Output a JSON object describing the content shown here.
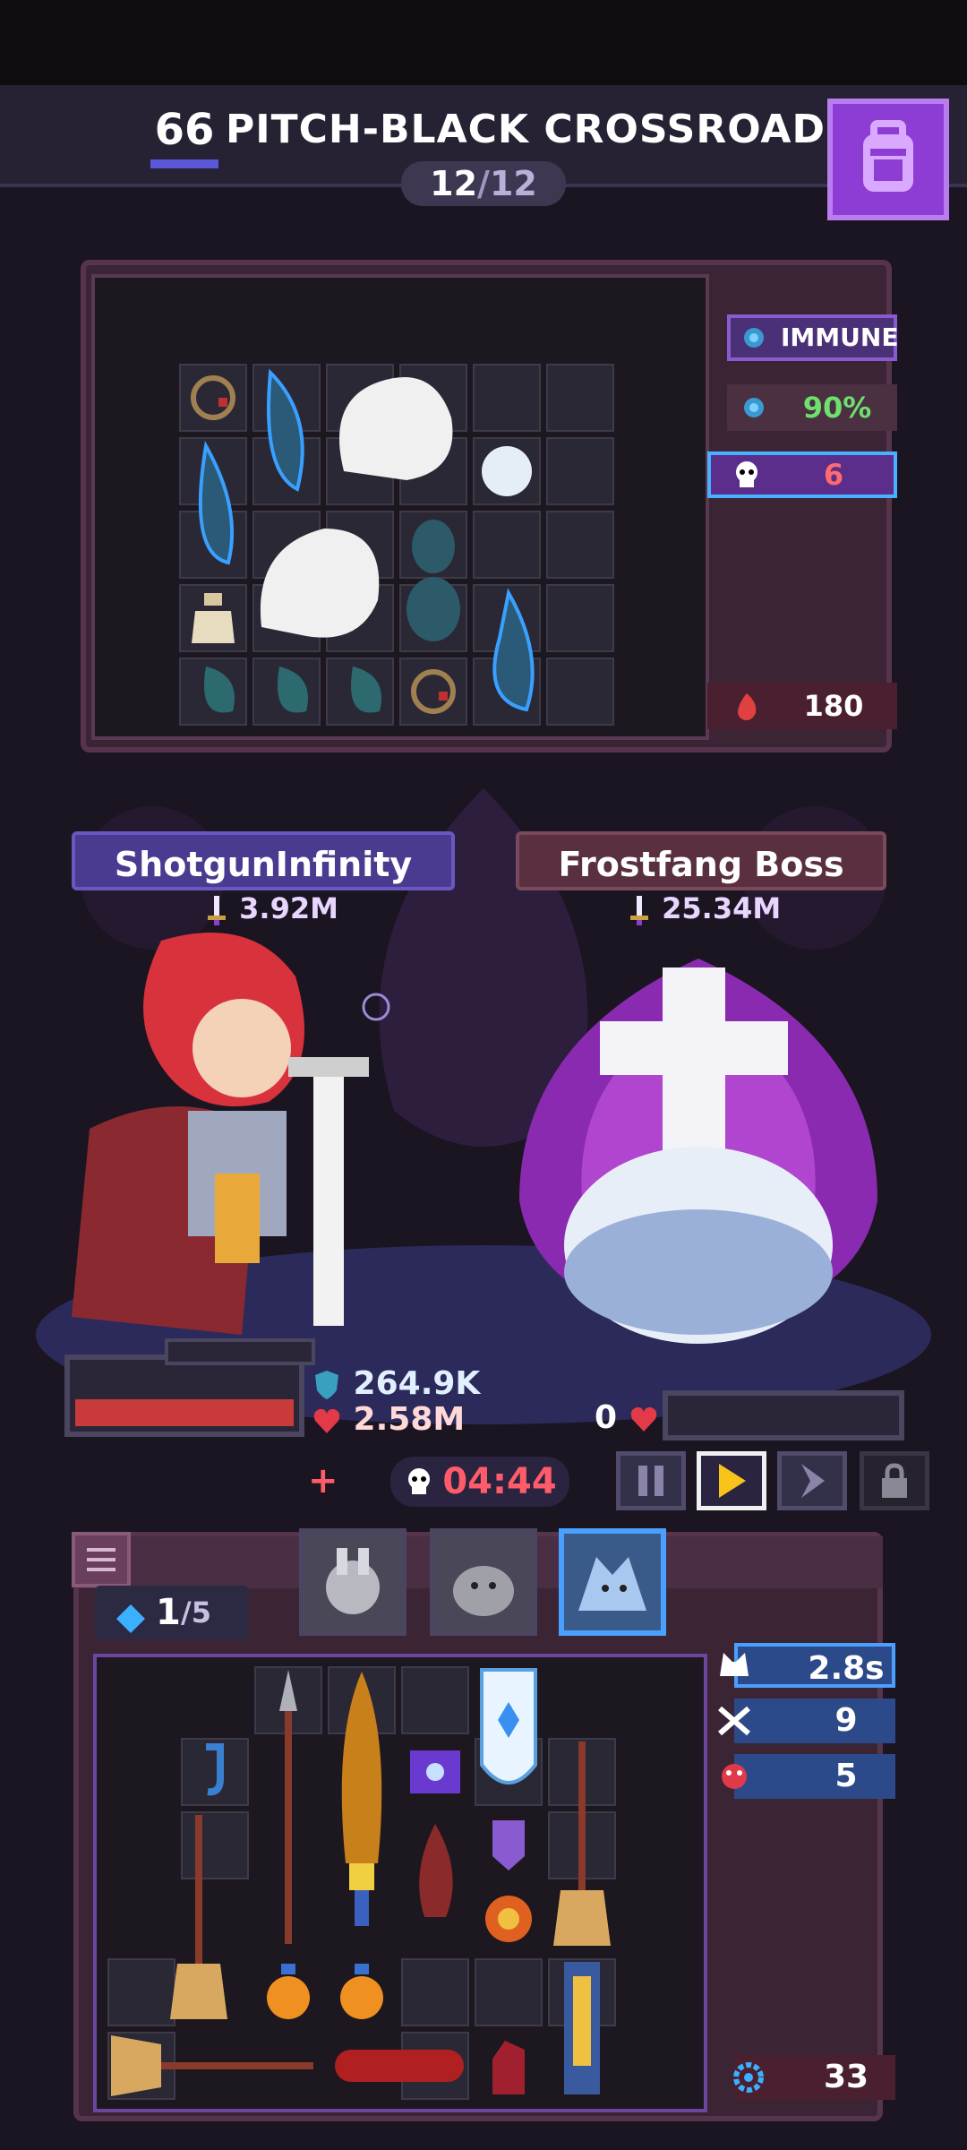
{
  "header": {
    "level": "66",
    "stage_name": "PITCH-BLACK CROSSROADS",
    "wave_current": "12",
    "wave_sep": "/",
    "wave_total": "12",
    "bag_icon": "backpack-icon"
  },
  "enemy_panel": {
    "status_immune": "IMMUNE",
    "status_percent": "90%",
    "skull_count": "6",
    "rage_value": "180"
  },
  "hero": {
    "name": "ShotgunInfinity",
    "power": "3.92M",
    "shield": "264.9K",
    "health": "2.58M"
  },
  "boss": {
    "name": "Frostfang Boss",
    "power": "25.34M",
    "health": "0"
  },
  "controls": {
    "timer": "04:44",
    "pause_icon": "pause-icon",
    "play_icon": "play-icon",
    "fast_forward_icon": "fast-forward-icon",
    "lock_icon": "lock-icon"
  },
  "inventory": {
    "gems_current": "1",
    "gems_total": "/5",
    "cooldown": "2.8s",
    "crossed_swords_count": "9",
    "monster_count": "5",
    "gear_count": "33"
  },
  "colors": {
    "accent_purple": "#8e3dd4",
    "hp_red": "#c93a3a",
    "timer_red": "#ff5c6a",
    "tag_blue": "#2c4a8a",
    "green_text": "#6ee06e"
  }
}
